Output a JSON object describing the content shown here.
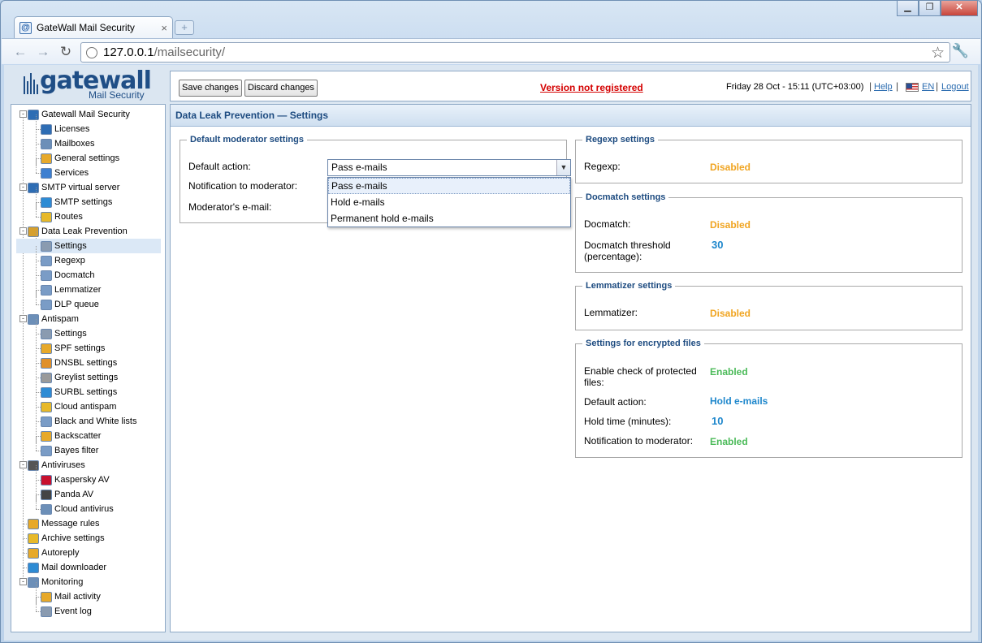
{
  "browser": {
    "tab_title": "GateWall Mail Security",
    "tab_close": "×",
    "new_tab": "+",
    "url_host": "127.0.0.1",
    "url_path": "/mailsecurity/"
  },
  "app": {
    "logo_name": "gatewall",
    "logo_sub": "Mail Security"
  },
  "topbar": {
    "save_label": "Save changes",
    "discard_label": "Discard changes",
    "version_text": "Version not registered",
    "datetime": "Friday 28 Oct - 15:11 (UTC+03:00)",
    "help": "Help",
    "lang": "EN",
    "logout": "Logout"
  },
  "sidebar": {
    "items": [
      {
        "label": "Gatewall Mail Security",
        "level": 0,
        "toggle": "-",
        "icon": "gatewall-icon",
        "color": "#2e6db4"
      },
      {
        "label": "Licenses",
        "level": 1,
        "icon": "info-icon",
        "color": "#2e6db4"
      },
      {
        "label": "Mailboxes",
        "level": 1,
        "icon": "mailbox-icon",
        "color": "#6c8fb8"
      },
      {
        "label": "General settings",
        "level": 1,
        "icon": "settings-icon",
        "color": "#e7a92a"
      },
      {
        "label": "Services",
        "level": 1,
        "icon": "services-icon",
        "color": "#3d7fd0"
      },
      {
        "label": "SMTP virtual server",
        "level": 0,
        "toggle": "-",
        "icon": "smtp-icon",
        "color": "#2e6db4"
      },
      {
        "label": "SMTP settings",
        "level": 1,
        "icon": "smtp-settings-icon",
        "color": "#2e8bd4"
      },
      {
        "label": "Routes",
        "level": 1,
        "icon": "routes-icon",
        "color": "#e7b92a"
      },
      {
        "label": "Data Leak Prevention",
        "level": 0,
        "toggle": "-",
        "icon": "dlp-icon",
        "color": "#d6a02e"
      },
      {
        "label": "Settings",
        "level": 1,
        "icon": "gear-icon",
        "color": "#8a9bb0",
        "selected": true
      },
      {
        "label": "Regexp",
        "level": 1,
        "icon": "regexp-icon",
        "color": "#7a9cc6"
      },
      {
        "label": "Docmatch",
        "level": 1,
        "icon": "docmatch-icon",
        "color": "#7a9cc6"
      },
      {
        "label": "Lemmatizer",
        "level": 1,
        "icon": "lemmatizer-icon",
        "color": "#7a9cc6"
      },
      {
        "label": "DLP queue",
        "level": 1,
        "icon": "queue-icon",
        "color": "#7a9cc6"
      },
      {
        "label": "Antispam",
        "level": 0,
        "toggle": "-",
        "icon": "antispam-icon",
        "color": "#6c8fb8"
      },
      {
        "label": "Settings",
        "level": 1,
        "icon": "gear-icon",
        "color": "#8a9bb0"
      },
      {
        "label": "SPF settings",
        "level": 1,
        "icon": "spf-icon",
        "color": "#e7a92a"
      },
      {
        "label": "DNSBL settings",
        "level": 1,
        "icon": "dnsbl-icon",
        "color": "#e0902a"
      },
      {
        "label": "Greylist settings",
        "level": 1,
        "icon": "greylist-icon",
        "color": "#9a9a9a"
      },
      {
        "label": "SURBL settings",
        "level": 1,
        "icon": "surbl-icon",
        "color": "#2e8bd4"
      },
      {
        "label": "Cloud antispam",
        "level": 1,
        "icon": "cloud-icon",
        "color": "#e7b92a"
      },
      {
        "label": "Black and White lists",
        "level": 1,
        "icon": "list-icon",
        "color": "#7a9cc6"
      },
      {
        "label": "Backscatter",
        "level": 1,
        "icon": "backscatter-icon",
        "color": "#e7a92a"
      },
      {
        "label": "Bayes filter",
        "level": 1,
        "icon": "bayes-icon",
        "color": "#7a9cc6"
      },
      {
        "label": "Antiviruses",
        "level": 0,
        "toggle": "-",
        "icon": "antivirus-icon",
        "color": "#555555"
      },
      {
        "label": "Kaspersky AV",
        "level": 1,
        "icon": "kaspersky-icon",
        "color": "#c8102e"
      },
      {
        "label": "Panda AV",
        "level": 1,
        "icon": "panda-icon",
        "color": "#444444"
      },
      {
        "label": "Cloud antivirus",
        "level": 1,
        "icon": "cloud-antivirus-icon",
        "color": "#6c8fb8"
      },
      {
        "label": "Message rules",
        "level": 0,
        "icon": "rules-icon",
        "color": "#e7a92a"
      },
      {
        "label": "Archive settings",
        "level": 0,
        "icon": "archive-icon",
        "color": "#e7b92a"
      },
      {
        "label": "Autoreply",
        "level": 0,
        "icon": "autoreply-icon",
        "color": "#e7a92a"
      },
      {
        "label": "Mail downloader",
        "level": 0,
        "icon": "downloader-icon",
        "color": "#2e8bd4"
      },
      {
        "label": "Monitoring",
        "level": 0,
        "toggle": "-",
        "icon": "monitoring-icon",
        "color": "#6c8fb8"
      },
      {
        "label": "Mail activity",
        "level": 1,
        "icon": "activity-icon",
        "color": "#e7a92a"
      },
      {
        "label": "Event log",
        "level": 1,
        "icon": "eventlog-icon",
        "color": "#8a9bb0"
      }
    ]
  },
  "content": {
    "title": "Data Leak Prevention — Settings",
    "moderator": {
      "legend": "Default moderator settings",
      "default_action_label": "Default action:",
      "default_action_value": "Pass e-mails",
      "notification_label": "Notification to moderator:",
      "email_label": "Moderator's e-mail:",
      "options": [
        "Pass e-mails",
        "Hold e-mails",
        "Permanent hold e-mails"
      ]
    },
    "regexp": {
      "legend": "Regexp settings",
      "label": "Regexp:",
      "value": "Disabled"
    },
    "docmatch": {
      "legend": "Docmatch settings",
      "label": "Docmatch:",
      "value": "Disabled",
      "threshold_label_1": "Docmatch threshold",
      "threshold_label_2": "(percentage):",
      "threshold_value": "30"
    },
    "lemmatizer": {
      "legend": "Lemmatizer settings",
      "label": "Lemmatizer:",
      "value": "Disabled"
    },
    "encrypted": {
      "legend": "Settings for encrypted files",
      "check_label_1": "Enable check of protected",
      "check_label_2": "files:",
      "check_value": "Enabled",
      "action_label": "Default action:",
      "action_value": "Hold e-mails",
      "hold_label": "Hold time (minutes):",
      "hold_value": "10",
      "notify_label": "Notification to moderator:",
      "notify_value": "Enabled"
    }
  }
}
